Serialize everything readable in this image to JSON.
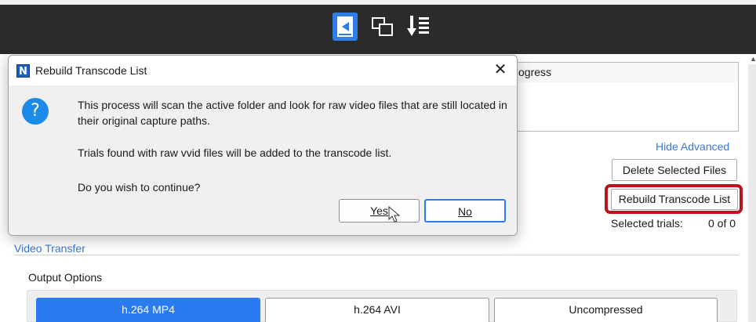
{
  "toolbar": {
    "icons": [
      "back-arrow-icon",
      "windows-icon",
      "download-list-icon"
    ]
  },
  "background": {
    "progress_header": "ogress",
    "hide_advanced": "Hide Advanced",
    "delete_button": "Delete Selected Files",
    "rebuild_button": "Rebuild Transcode List",
    "selected_trials_label": "Selected trials:",
    "selected_trials_value": "0 of 0",
    "section_title": "Video Transfer",
    "output_options_label": "Output Options",
    "output_options": [
      "h.264 MP4",
      "h.264 AVI",
      "Uncompressed"
    ],
    "selected_output": "h.264 MP4"
  },
  "dialog": {
    "title": "Rebuild Transcode List",
    "close": "✕",
    "message_line1": "This process will scan the active folder and look for raw video files that are still located in their original capture paths.",
    "message_line2": "Trials found with raw vvid files will be added to the transcode list.",
    "message_line3": "Do you wish to continue?",
    "yes_label": "Yes",
    "no_label": "No"
  },
  "colors": {
    "accent": "#2a7bf0",
    "link": "#3a78d6",
    "highlight": "#b8151e",
    "toolbar_bg": "#2b2b2b"
  }
}
